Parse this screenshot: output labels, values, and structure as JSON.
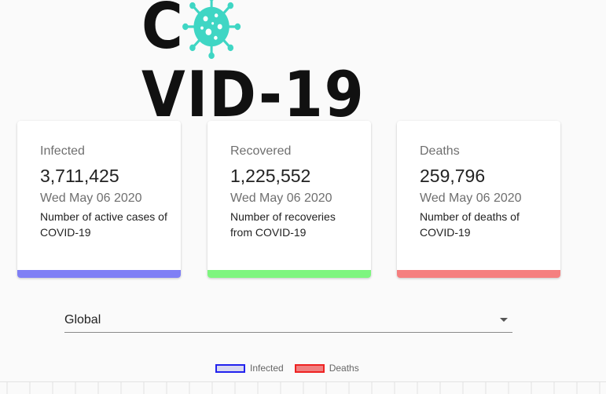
{
  "logo": {
    "text_before": "C",
    "text_after": "VID-19",
    "virus_icon": "coronavirus-icon",
    "virus_color": "#3fd6c4"
  },
  "cards": [
    {
      "title": "Infected",
      "value": "3,711,425",
      "date": "Wed May 06 2020",
      "description": "Number of active cases of COVID-19",
      "bar_color": "#7f7ff5"
    },
    {
      "title": "Recovered",
      "value": "1,225,552",
      "date": "Wed May 06 2020",
      "description": "Number of recoveries from COVID-19",
      "bar_color": "#7ef57f"
    },
    {
      "title": "Deaths",
      "value": "259,796",
      "date": "Wed May 06 2020",
      "description": "Number of deaths of COVID-19",
      "bar_color": "#f57f7f"
    }
  ],
  "country_select": {
    "value": "Global",
    "arrow_icon": "dropdown-arrow-icon"
  },
  "legend": [
    {
      "label": "Infected",
      "border": "#2222ee",
      "fill": "#d8d8f0"
    },
    {
      "label": "Deaths",
      "border": "#ee2222",
      "fill": "#f08080"
    }
  ]
}
